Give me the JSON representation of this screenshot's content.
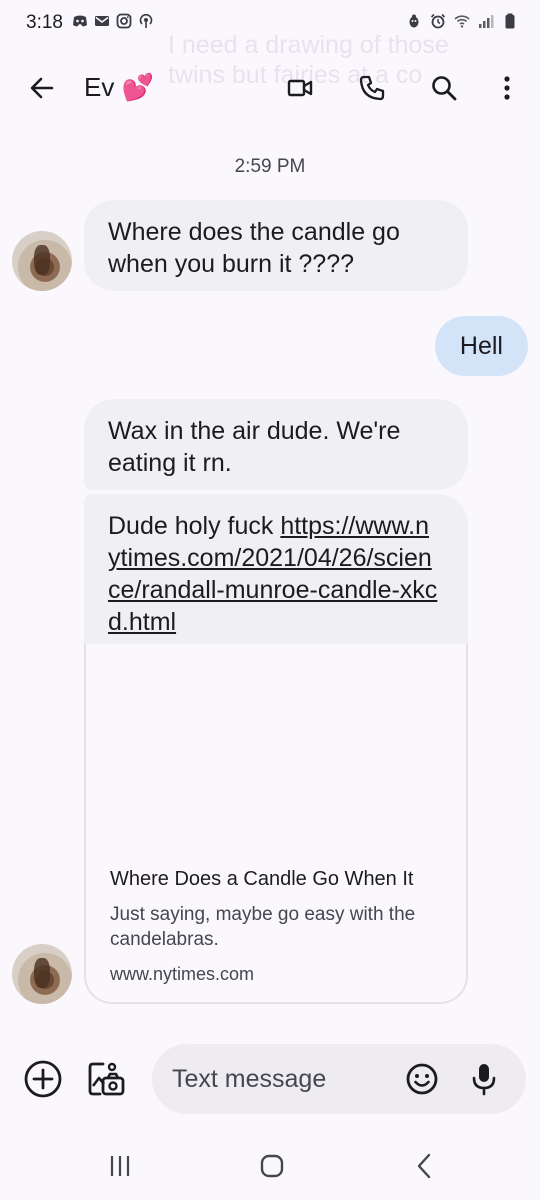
{
  "status_bar": {
    "time": "3:18",
    "left_icons": [
      "discord-icon",
      "mail-icon",
      "instagram-icon",
      "podcast-icon"
    ],
    "right_icons": [
      "bug-icon",
      "alarm-icon",
      "wifi-icon",
      "signal-icon",
      "battery-icon"
    ]
  },
  "notification_ghost": "I need a drawing of those twins but fairies at a co",
  "header": {
    "contact_name": "Ev 💕",
    "icons": [
      "back-arrow-icon",
      "video-call-icon",
      "phone-icon",
      "search-icon",
      "more-vert-icon"
    ]
  },
  "conversation": {
    "timestamp": "2:59 PM",
    "messages": [
      {
        "direction": "incoming",
        "text": "Where does the candle go when you burn it ????"
      },
      {
        "direction": "outgoing",
        "text": "Hell"
      },
      {
        "direction": "incoming",
        "text": "Wax in the air dude. We're eating it rn."
      },
      {
        "direction": "incoming",
        "text_prefix": "Dude holy fuck ",
        "link": "https://www.nytimes.com/2021/04/26/science/randall-munroe-candle-xkcd.html"
      }
    ],
    "link_preview": {
      "title": "Where Does a Candle Go When It",
      "description": "Just saying, maybe go easy with the candelabras.",
      "domain": "www.nytimes.com"
    }
  },
  "compose": {
    "placeholder": "Text message"
  },
  "colors": {
    "background": "#fbf8fd",
    "incoming_bubble": "#f0eff3",
    "outgoing_bubble": "#d4e4f8"
  }
}
